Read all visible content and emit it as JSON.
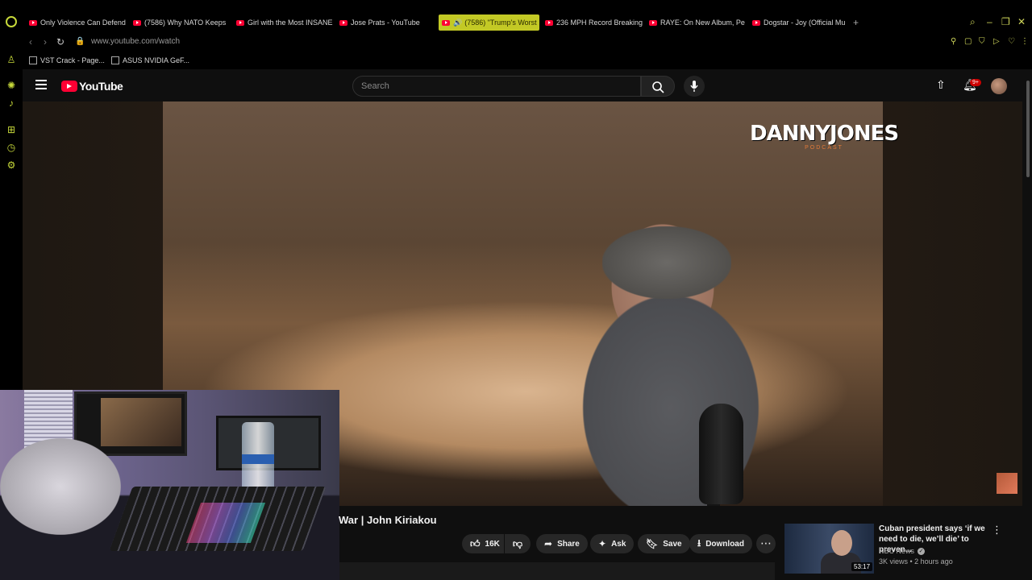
{
  "browser": {
    "tabs": [
      {
        "label": "Only Violence Can Defend",
        "active": false
      },
      {
        "label": "(7586) Why NATO Keeps",
        "active": false
      },
      {
        "label": "Girl with the Most INSANE",
        "active": false
      },
      {
        "label": "Jose Prats - YouTube",
        "active": false
      },
      {
        "label": "(7586) \"Trump's Worst",
        "active": true
      },
      {
        "label": "236 MPH Record Breaking",
        "active": false
      },
      {
        "label": "RAYE: On New Album, Pe",
        "active": false
      },
      {
        "label": "Dogstar - Joy (Official Mu",
        "active": false
      }
    ],
    "new_tab_label": "+",
    "url": "www.youtube.com/watch",
    "bookmarks": [
      {
        "label": "VST Crack - Page..."
      },
      {
        "label": "ASUS NVIDIA GeF..."
      }
    ]
  },
  "youtube": {
    "logo_text": "YouTube",
    "search_placeholder": "Search",
    "notification_count": "9+",
    "channel_watermark": {
      "big": "DANNYJONES",
      "small": "PODCAST"
    },
    "video_title": "War | John Kiriakou",
    "actions": {
      "like_count": "16K",
      "share_label": "Share",
      "ask_label": "Ask",
      "save_label": "Save",
      "download_label": "Download"
    },
    "recommendation": {
      "title": "Cuban president says ‘if we need to die, we’ll die’ to preven...",
      "channel": "NBC News",
      "meta": "3K views • 2 hours ago",
      "duration": "53:17"
    }
  },
  "colors": {
    "accent": "#c3c925",
    "youtube_red": "#ff0033",
    "background": "#0f0f0f"
  }
}
